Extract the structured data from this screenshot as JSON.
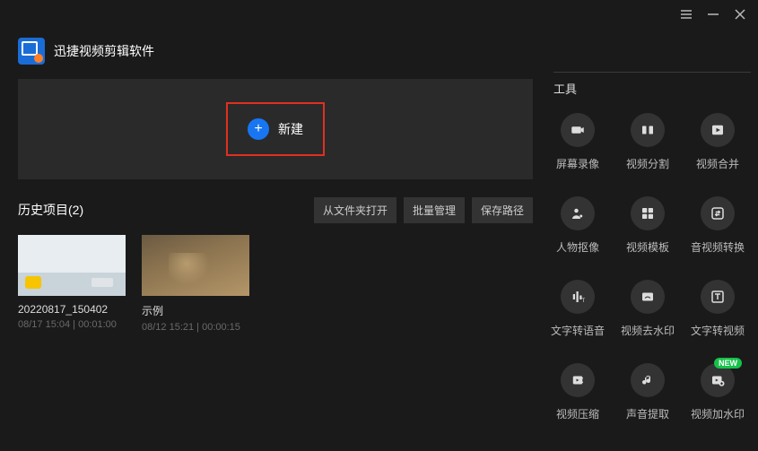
{
  "window": {
    "app_title": "迅捷视频剪辑软件"
  },
  "new_panel": {
    "button_label": "新建"
  },
  "history": {
    "title": "历史项目(2)",
    "actions": {
      "open_from_folder": "从文件夹打开",
      "batch_manage": "批量管理",
      "save_path": "保存路径"
    },
    "projects": [
      {
        "name": "20220817_150402",
        "meta": "08/17 15:04 | 00:01:00"
      },
      {
        "name": "示例",
        "meta": "08/12 15:21 | 00:00:15"
      }
    ]
  },
  "tools": {
    "header": "工具",
    "items": [
      {
        "label": "屏幕录像",
        "icon": "camera"
      },
      {
        "label": "视频分割",
        "icon": "split"
      },
      {
        "label": "视频合并",
        "icon": "play"
      },
      {
        "label": "人物抠像",
        "icon": "person"
      },
      {
        "label": "视频模板",
        "icon": "template"
      },
      {
        "label": "音视频转换",
        "icon": "convert"
      },
      {
        "label": "文字转语音",
        "icon": "tts"
      },
      {
        "label": "视频去水印",
        "icon": "nowm"
      },
      {
        "label": "文字转视频",
        "icon": "t2v"
      },
      {
        "label": "视频压缩",
        "icon": "compress"
      },
      {
        "label": "声音提取",
        "icon": "audio"
      },
      {
        "label": "视频加水印",
        "icon": "addwm",
        "badge": "NEW"
      }
    ]
  }
}
